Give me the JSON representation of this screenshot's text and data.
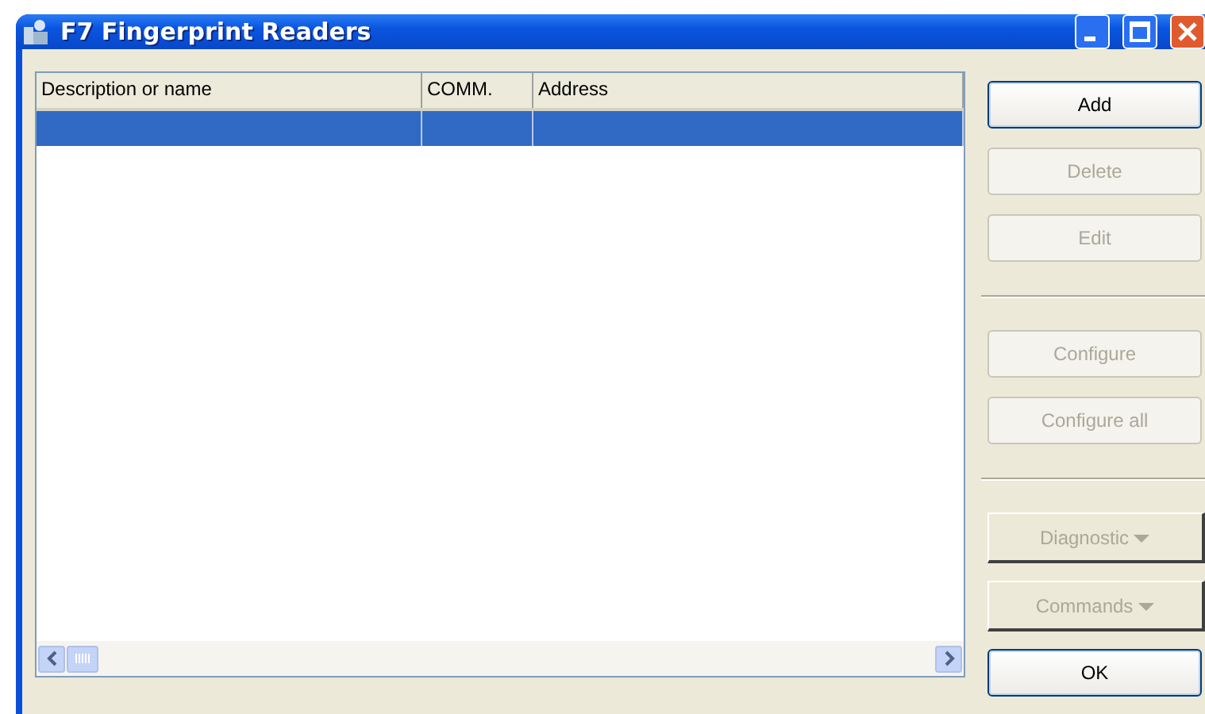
{
  "window": {
    "title": "F7 Fingerprint Readers"
  },
  "table": {
    "columns": [
      "Description or name",
      "COMM.",
      "Address"
    ],
    "rows": [
      {
        "selected": true
      }
    ]
  },
  "buttons": [
    {
      "label": "Add",
      "kind": "push",
      "disabled": false
    },
    {
      "label": "Delete",
      "kind": "push",
      "disabled": true
    },
    {
      "label": "Edit",
      "kind": "push",
      "disabled": true
    },
    {
      "kind": "separator"
    },
    {
      "label": "Configure",
      "kind": "push",
      "disabled": true
    },
    {
      "label": "Configure all",
      "kind": "push",
      "disabled": true
    },
    {
      "kind": "separator"
    },
    {
      "label": "Diagnostic",
      "kind": "dropdown",
      "disabled": true
    },
    {
      "label": "Commands",
      "kind": "dropdown",
      "disabled": true
    },
    {
      "label": "OK",
      "kind": "push",
      "disabled": false
    }
  ]
}
